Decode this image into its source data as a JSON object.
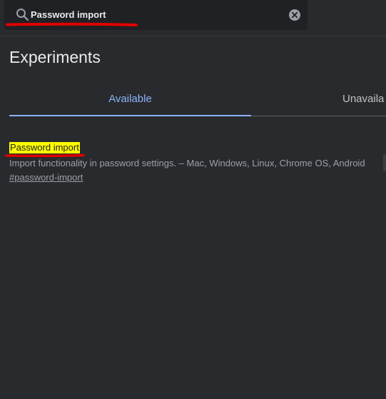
{
  "search": {
    "value": "Password import"
  },
  "header": {
    "title": "Experiments"
  },
  "tabs": [
    {
      "label": "Available",
      "selected": true
    },
    {
      "label": "Unavaila",
      "selected": false
    }
  ],
  "experiment": {
    "name": "Password import",
    "description": "Import functionality in password settings. – Mac, Windows, Linux, Chrome OS, Android",
    "link": "#password-import"
  },
  "icons": {
    "search": "search-icon",
    "clear": "clear-icon"
  },
  "colors": {
    "background": "#292a2d",
    "search_bg": "#202124",
    "accent": "#8ab4f8",
    "highlight": "#ffff00",
    "annotation": "#e00000"
  }
}
